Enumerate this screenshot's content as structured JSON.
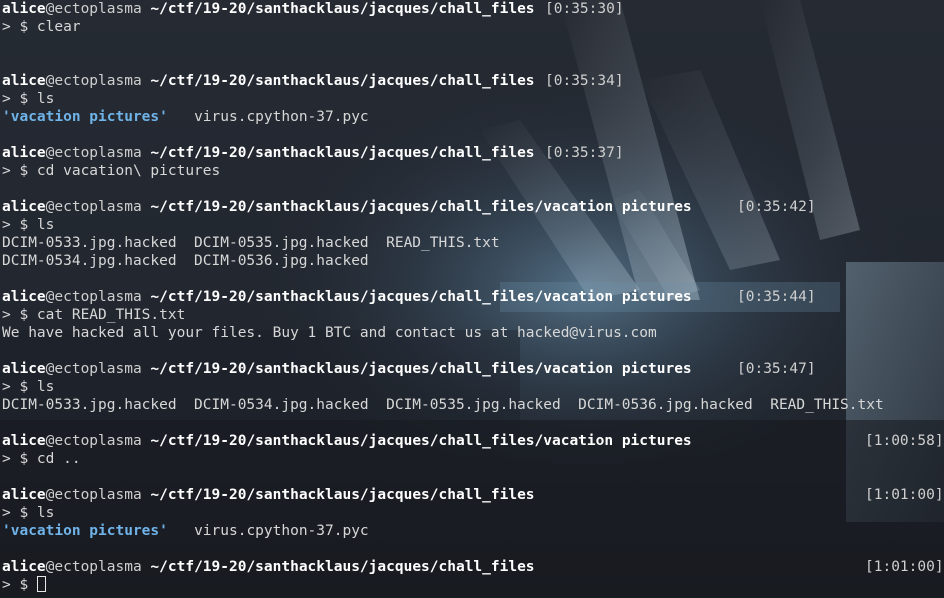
{
  "terminal": {
    "user": "alice",
    "host": "@ectoplasma",
    "prompt_symbol": "> $ ",
    "blocks": [
      {
        "path": "~/ctf/19-20/santhacklaus/jacques/chall_files",
        "time": "[0:35:30]",
        "command": "clear",
        "output": []
      },
      {
        "path": "~/ctf/19-20/santhacklaus/jacques/chall_files",
        "time": "[0:35:34]",
        "command": "ls",
        "output_dir": "'vacation pictures'",
        "output_rest": "   virus.cpython-37.pyc"
      },
      {
        "path": "~/ctf/19-20/santhacklaus/jacques/chall_files",
        "time": "[0:35:37]",
        "command": "cd vacation\\ pictures"
      },
      {
        "path": "~/ctf/19-20/santhacklaus/jacques/chall_files/vacation pictures",
        "time": "[0:35:42]",
        "command": "ls",
        "output": [
          "DCIM-0533.jpg.hacked  DCIM-0535.jpg.hacked  READ_THIS.txt",
          "DCIM-0534.jpg.hacked  DCIM-0536.jpg.hacked"
        ]
      },
      {
        "path": "~/ctf/19-20/santhacklaus/jacques/chall_files/vacation pictures",
        "time": "[0:35:44]",
        "command": "cat READ_THIS.txt",
        "output": [
          "We have hacked all your files. Buy 1 BTC and contact us at hacked@virus.com"
        ]
      },
      {
        "path": "~/ctf/19-20/santhacklaus/jacques/chall_files/vacation pictures",
        "time": "[0:35:47]",
        "command": "ls",
        "output": [
          "DCIM-0533.jpg.hacked  DCIM-0534.jpg.hacked  DCIM-0535.jpg.hacked  DCIM-0536.jpg.hacked  READ_THIS.txt"
        ]
      },
      {
        "path": "~/ctf/19-20/santhacklaus/jacques/chall_files/vacation pictures",
        "time": "[1:00:58]",
        "command": "cd .."
      },
      {
        "path": "~/ctf/19-20/santhacklaus/jacques/chall_files",
        "time": "[1:01:00]",
        "command": "ls",
        "output_dir": "'vacation pictures'",
        "output_rest": "   virus.cpython-37.pyc"
      },
      {
        "path": "~/ctf/19-20/santhacklaus/jacques/chall_files",
        "time": "[1:01:00]",
        "command": ""
      }
    ]
  },
  "colors": {
    "background": "#1b1f27",
    "text": "#d7d7d7",
    "directory": "#6fb3e8",
    "bold_white": "#ffffff"
  }
}
